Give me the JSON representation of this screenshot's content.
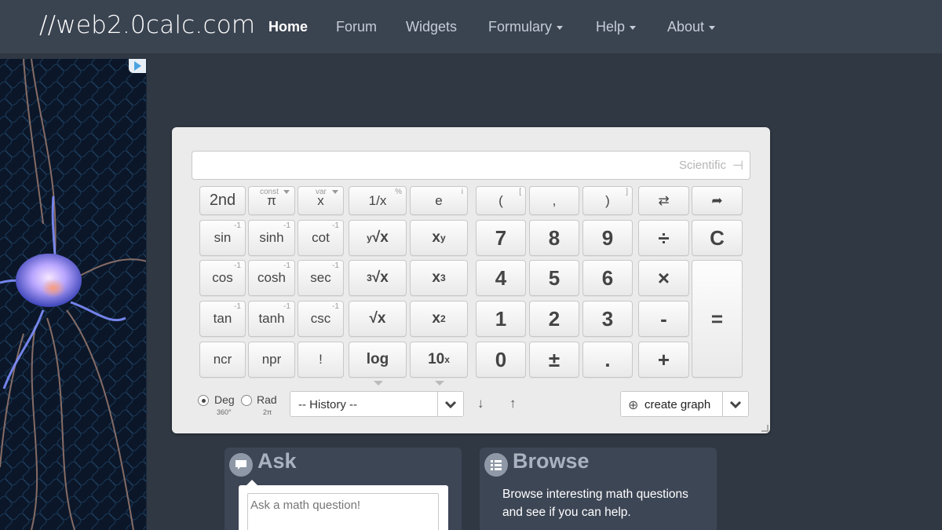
{
  "brand": "//web2.0calc.com",
  "nav": [
    {
      "label": "Home",
      "active": true,
      "dropdown": false
    },
    {
      "label": "Forum",
      "active": false,
      "dropdown": false
    },
    {
      "label": "Widgets",
      "active": false,
      "dropdown": false
    },
    {
      "label": "Formulary",
      "active": false,
      "dropdown": true
    },
    {
      "label": "Help",
      "active": false,
      "dropdown": true
    },
    {
      "label": "About",
      "active": false,
      "dropdown": true
    }
  ],
  "calculator": {
    "mode_label": "Scientific",
    "mode_icon": "scientific-keypad-icon",
    "row0": [
      {
        "label": "2nd"
      },
      {
        "label": "π",
        "hint": "const"
      },
      {
        "label": "x",
        "hint": "var"
      },
      {
        "label": "1/x",
        "hint": "%"
      },
      {
        "label": "e",
        "hint": "i"
      },
      {
        "label": "(",
        "hint": "["
      },
      {
        "label": ","
      },
      {
        "label": ")",
        "hint": "]"
      },
      {
        "label": "⇄",
        "icon": "swap-icon"
      },
      {
        "label": "➦",
        "icon": "redo-arrow-icon"
      }
    ],
    "functions": [
      [
        {
          "label": "sin",
          "hint": "-1"
        },
        {
          "label": "sinh",
          "hint": "-1"
        },
        {
          "label": "cot",
          "hint": "-1"
        }
      ],
      [
        {
          "label": "cos",
          "hint": "-1"
        },
        {
          "label": "cosh",
          "hint": "-1"
        },
        {
          "label": "sec",
          "hint": "-1"
        }
      ],
      [
        {
          "label": "tan",
          "hint": "-1"
        },
        {
          "label": "tanh",
          "hint": "-1"
        },
        {
          "label": "csc",
          "hint": "-1"
        }
      ],
      [
        {
          "label": "ncr"
        },
        {
          "label": "npr"
        },
        {
          "label": "!"
        }
      ]
    ],
    "powers": [
      [
        {
          "pre": "y",
          "main": "√x"
        },
        {
          "main": "x",
          "sup": "y"
        }
      ],
      [
        {
          "pre": "3",
          "main": "√x"
        },
        {
          "main": "x",
          "sup": "3"
        }
      ],
      [
        {
          "main": "√x"
        },
        {
          "main": "x",
          "sup": "2"
        }
      ],
      [
        {
          "main": "log"
        },
        {
          "main": "10",
          "sup": "x"
        }
      ]
    ],
    "digits": [
      [
        "7",
        "8",
        "9"
      ],
      [
        "4",
        "5",
        "6"
      ],
      [
        "1",
        "2",
        "3"
      ],
      [
        "0",
        "±",
        "."
      ]
    ],
    "operators": [
      "÷",
      "×",
      "-",
      "+"
    ],
    "clear": "C",
    "equals": "=",
    "angle_modes": [
      {
        "label": "Deg",
        "sub": "360°",
        "checked": true
      },
      {
        "label": "Rad",
        "sub": "2π",
        "checked": false
      }
    ],
    "history_label": "-- History --",
    "down_arrow": "↓",
    "up_arrow": "↑",
    "graph_label": "create graph"
  },
  "ask": {
    "title": "Ask",
    "placeholder": "Ask a math question!"
  },
  "browse": {
    "title": "Browse",
    "text": "Browse interesting math questions and see if you can help."
  }
}
